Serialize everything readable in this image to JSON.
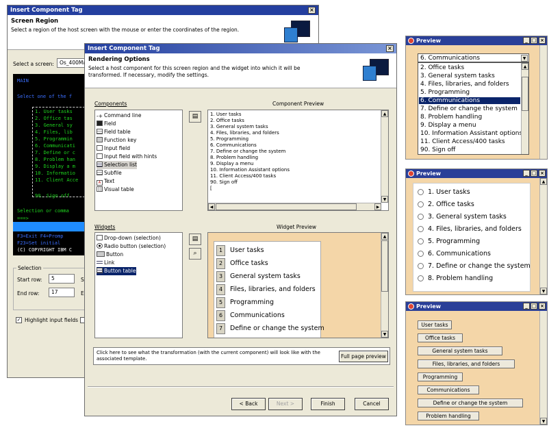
{
  "dialog_back": {
    "title": "Insert Component Tag",
    "header_title": "Screen Region",
    "header_desc": "Select a region of the host screen with the mouse or enter the coordinates of the region.",
    "select_screen_label": "Select a screen:",
    "select_screen_value": "Os_400Ma",
    "terminal_lines": [
      "MAIN",
      "Select one of the f",
      "1. User tasks",
      "2. Office tas",
      "3. General sy",
      "4. Files, lib",
      "5. Programmin",
      "6. Communicati",
      "7. Define or c",
      "8. Problem han",
      "9. Display a m",
      "10. Informatio",
      "11. Client Acce",
      "90. Sign off",
      "Selection or comma",
      "===>",
      "F3=Exit  F4=Promp",
      "F23=Set initial",
      "(C) COPYRIGHT IBM C"
    ],
    "selection_group": "Selection",
    "start_row_label": "Start row:",
    "start_row_value": "5",
    "end_row_label": "End row:",
    "end_row_value": "17",
    "start_col_label": "St",
    "end_col_label": "En",
    "highlight_label": "Highlight input fields"
  },
  "dialog_front": {
    "title": "Insert Component Tag",
    "header_title": "Rendering Options",
    "header_desc": "Select a host component for this screen region and the widget into which it will be transformed.  If necessary, modify the settings.",
    "components_label": "Components",
    "components": [
      "Command line",
      "Field",
      "Field table",
      "Function key",
      "Input field",
      "Input field with hints",
      "Selection list",
      "Subfile",
      "Text",
      "Visual table"
    ],
    "components_selected": "Selection list",
    "component_preview_label": "Component Preview",
    "component_preview_lines": [
      "1. User tasks",
      "2. Office tasks",
      "3. General system tasks",
      "4. Files, libraries, and folders",
      "5. Programming",
      "6. Communications",
      "7. Define or change the system",
      "8. Problem handling",
      "9. Display a menu",
      "10. Information Assistant options",
      "11. Client Access/400 tasks",
      "90. Sign off",
      "["
    ],
    "widgets_label": "Widgets",
    "widgets": [
      "Drop-down (selection)",
      "Radio button (selection)",
      "Button",
      "Link",
      "Button table"
    ],
    "widgets_selected": "Button table",
    "widget_preview_label": "Widget Preview",
    "widget_preview_rows": [
      {
        "num": "1",
        "text": "User tasks"
      },
      {
        "num": "2",
        "text": "Office tasks"
      },
      {
        "num": "3",
        "text": "General system tasks"
      },
      {
        "num": "4",
        "text": "Files, libraries, and folders"
      },
      {
        "num": "5",
        "text": "Programming"
      },
      {
        "num": "6",
        "text": "Communications"
      },
      {
        "num": "7",
        "text": "Define or change the system"
      }
    ],
    "hint_text": "Click here to see what the transformation (with the current component) will look like with the associated template.",
    "full_page_preview": "Full page preview",
    "back": "< Back",
    "next": "Next >",
    "finish": "Finish",
    "cancel": "Cancel"
  },
  "preview_dropdown": {
    "title": "Preview",
    "selected_value": "6. Communications",
    "options": [
      "2. Office tasks",
      "3. General system tasks",
      "4. Files, libraries, and folders",
      "5. Programming",
      "6. Communications",
      "7. Define or change the system",
      "8. Problem handling",
      "9. Display a menu",
      "10. Information Assistant options",
      "11. Client Access/400 tasks",
      "90. Sign off"
    ],
    "highlighted": "6. Communications"
  },
  "preview_radio": {
    "title": "Preview",
    "options": [
      "1. User tasks",
      "2. Office tasks",
      "3. General system tasks",
      "4. Files, libraries, and folders",
      "5. Programming",
      "6. Communications",
      "7. Define or change the system",
      "8. Problem handling"
    ]
  },
  "preview_buttons": {
    "title": "Preview",
    "buttons": [
      "User tasks",
      "Office tasks",
      "General system tasks",
      "Files, libraries, and folders",
      "Programming",
      "Communications",
      "Define or change the system",
      "Problem handling"
    ]
  },
  "colors": {
    "titlebar": "#243f9f",
    "preview_bg": "#f4d6a8",
    "terminal_bg": "#000000",
    "terminal_text": "#1fd61f",
    "selection": "#0a246a"
  }
}
